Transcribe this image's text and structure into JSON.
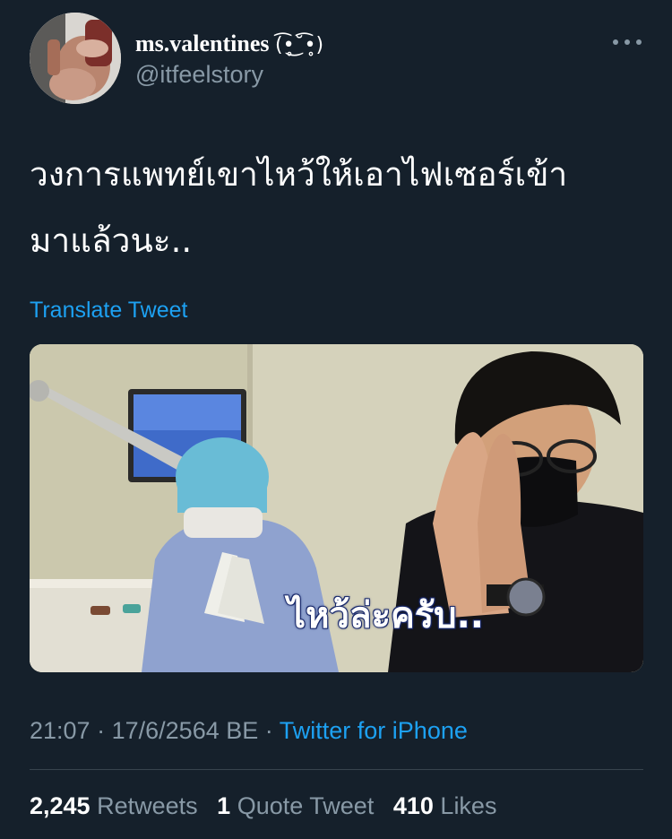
{
  "author": {
    "display_name": "ms.valentines (͡•̥ ͜˘ ͡•̥)",
    "display_name_text": "ms.valentines",
    "display_name_kaomoji": "(͡•̥͜˘͡•̥)",
    "handle": "@itfeelstory",
    "avatar_icon": "profile-photo-avatar"
  },
  "tweet": {
    "text_line1": "วงการแพทย์เขาไหว้ให้เอาไฟเซอร์เข้า",
    "text_line2": "มาแล้วนะ..",
    "translate_label": "Translate Tweet",
    "media_caption": "ไหว้ล่ะครับ..",
    "time": "21:07",
    "date": "17/6/2564 BE",
    "source": "Twitter for iPhone",
    "separator": "·"
  },
  "stats": {
    "retweets_count": "2,245",
    "retweets_label": "Retweets",
    "quotes_count": "1",
    "quotes_label": "Quote Tweet",
    "likes_count": "410",
    "likes_label": "Likes"
  },
  "colors": {
    "background": "#15202b",
    "text_primary": "#ffffff",
    "text_secondary": "#8899a6",
    "accent": "#1da1f2",
    "divider": "#38444d"
  },
  "icons": {
    "more": "more-horizontal-icon"
  }
}
